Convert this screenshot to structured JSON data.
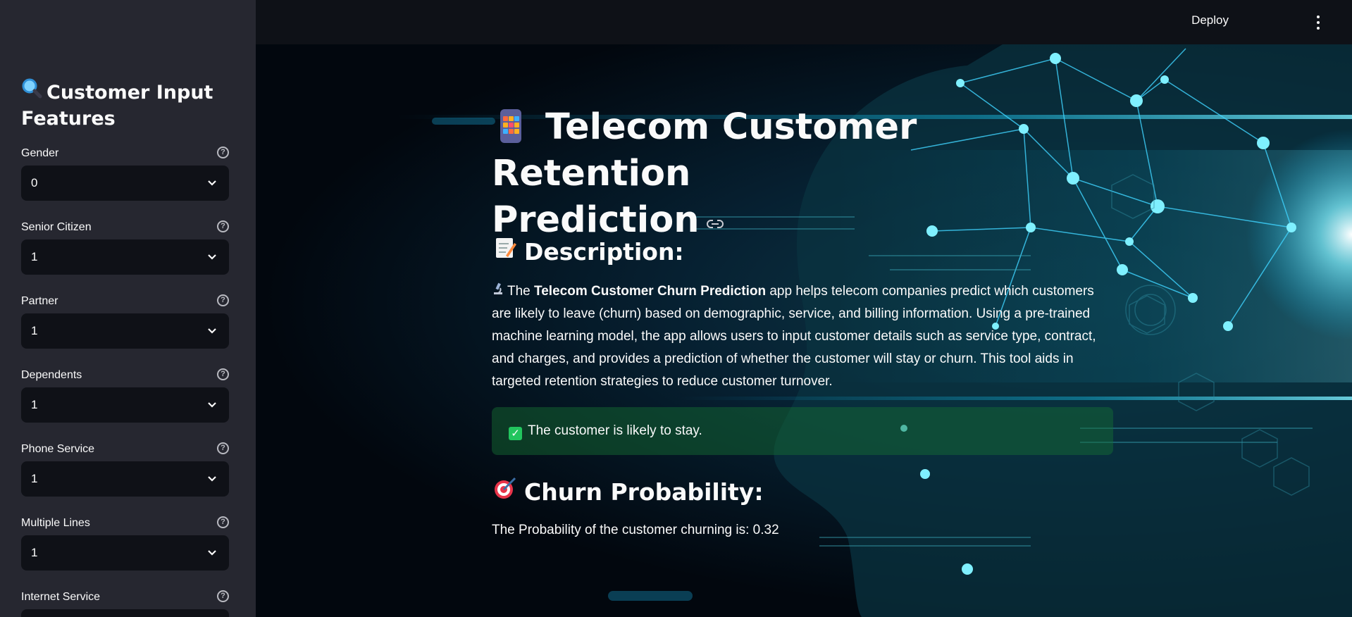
{
  "header": {
    "deploy_label": "Deploy"
  },
  "sidebar": {
    "title": "Customer Input Features",
    "title_icon": "magnifier-icon",
    "fields": [
      {
        "label": "Gender",
        "value": "0"
      },
      {
        "label": "Senior Citizen",
        "value": "1"
      },
      {
        "label": "Partner",
        "value": "1"
      },
      {
        "label": "Dependents",
        "value": "1"
      },
      {
        "label": "Phone Service",
        "value": "1"
      },
      {
        "label": "Multiple Lines",
        "value": "1"
      },
      {
        "label": "Internet Service",
        "value": ""
      }
    ]
  },
  "main": {
    "title_line1": "Telecom Customer Retention",
    "title_line2": "Prediction",
    "description_heading": "Description:",
    "description_lead": "The ",
    "description_bold": "Telecom Customer Churn Prediction",
    "description_rest": " app helps telecom companies predict which customers are likely to leave (churn) based on demographic, service, and billing information. Using a pre-trained machine learning model, the app allows users to input customer details such as service type, contract, and charges, and provides a prediction of whether the customer will stay or churn. This tool aids in targeted retention strategies to reduce customer turnover.",
    "success_message": "The customer is likely to stay.",
    "probability_heading": "Churn Probability:",
    "probability_text": "The Probability of the customer churning is: 0.32"
  },
  "colors": {
    "sidebar_bg": "#262730",
    "header_bg": "#0e1117",
    "select_bg": "#0f1117",
    "success_bg": "#177233",
    "accent_cyan": "#3fd4ff"
  }
}
